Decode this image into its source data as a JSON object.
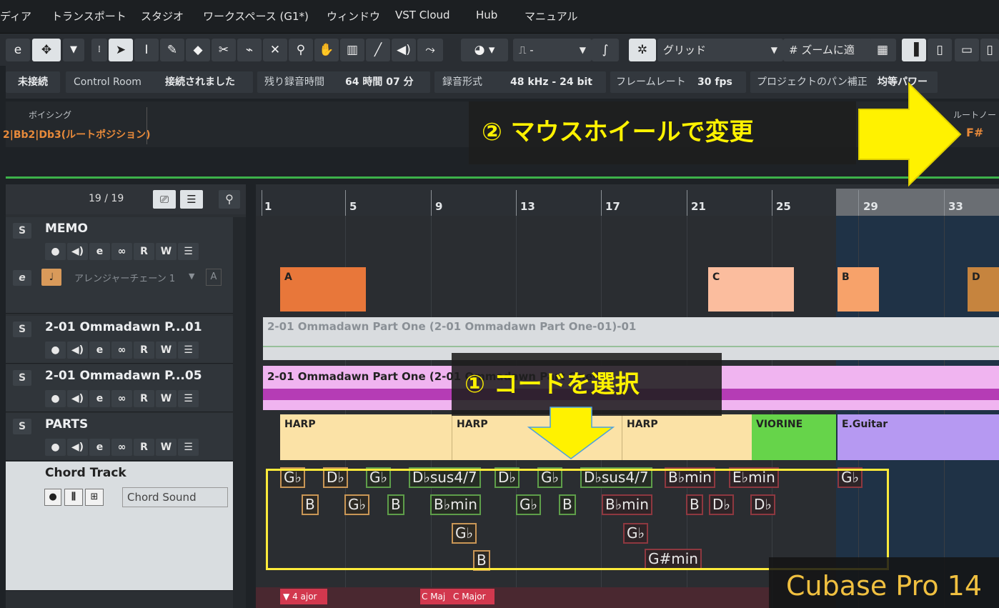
{
  "menu": [
    "ディア",
    "トランスポート",
    "スタジオ",
    "ワークスペース (G1*)",
    "ウィンドウ",
    "VST Cloud",
    "Hub",
    "マニュアル"
  ],
  "toolbar": {
    "quantize_glyph": "⎍ -",
    "snap_label": "グリッド",
    "zoom_label": "ズームに適"
  },
  "status": {
    "connection": "未接続",
    "control_room_label": "Control Room",
    "control_room_value": "接続されました",
    "rec_time_label": "残り録音時間",
    "rec_time_value": "64 時間 07 分",
    "rec_format_label": "録音形式",
    "rec_format_value": "48 kHz - 24 bit",
    "frame_rate_label": "フレームレート",
    "frame_rate_value": "30 fps",
    "pan_label": "プロジェクトのパン補正",
    "pan_value": "均等パワー"
  },
  "info": {
    "voicing_label": "ボイシング",
    "voicing_value": "2|Bb2|Db3(ルートポジション)",
    "root_label": "ルートノート",
    "root_value": "F#"
  },
  "tracklist": {
    "count": "19 / 19",
    "tracks": [
      {
        "solo": "S",
        "name": "MEMO"
      },
      {
        "name": "アレンジャーチェーン 1",
        "suffix": "A"
      },
      {
        "solo": "S",
        "name": "2-01 Ommadawn P...01"
      },
      {
        "solo": "S",
        "name": "2-01 Ommadawn P...05"
      },
      {
        "solo": "S",
        "name": "PARTS"
      },
      {
        "name": "Chord Track",
        "sound": "Chord Sound"
      }
    ],
    "ctrl_labels": [
      "●",
      "◀)",
      "e",
      "∞",
      "R",
      "W",
      "☰"
    ]
  },
  "ruler": [
    "1",
    "5",
    "9",
    "13",
    "17",
    "21",
    "25",
    "29",
    "33"
  ],
  "arranger": [
    "A",
    "C",
    "B",
    "D"
  ],
  "audio": {
    "event1": "2-01 Ommadawn Part One (2-01 Ommadawn Part One-01)-01",
    "event2": "2-01 Ommadawn Part One (2-01 Ommadawn Part One-"
  },
  "parts": [
    "HARP",
    "HARP",
    "HARP",
    "VIORINE",
    "E.Guitar"
  ],
  "chords": {
    "row1": [
      "G♭",
      "D♭",
      "G♭",
      "D♭sus4/7",
      "D♭",
      "G♭",
      "D♭sus4/7",
      "B♭min",
      "E♭min",
      "G♭"
    ],
    "row2": [
      "B",
      "G♭",
      "B",
      "B♭min",
      "G♭",
      "B",
      "B♭min",
      "B",
      "D♭",
      "D♭"
    ],
    "row3": [
      "G♭",
      "G♭"
    ],
    "row4": [
      "B",
      "G#min"
    ]
  },
  "scale": [
    "4",
    "ajor",
    "C Maj",
    "C Major"
  ],
  "annotations": {
    "step2": "② マウスホイールで変更",
    "step1": "① コードを選択",
    "brand": "Cubase Pro 14"
  },
  "colors": {
    "accent_yellow": "#fff200",
    "arranger_orange": "#e8773a",
    "chord_highlight": "#ffeb3b",
    "track_green": "#3db24a"
  }
}
